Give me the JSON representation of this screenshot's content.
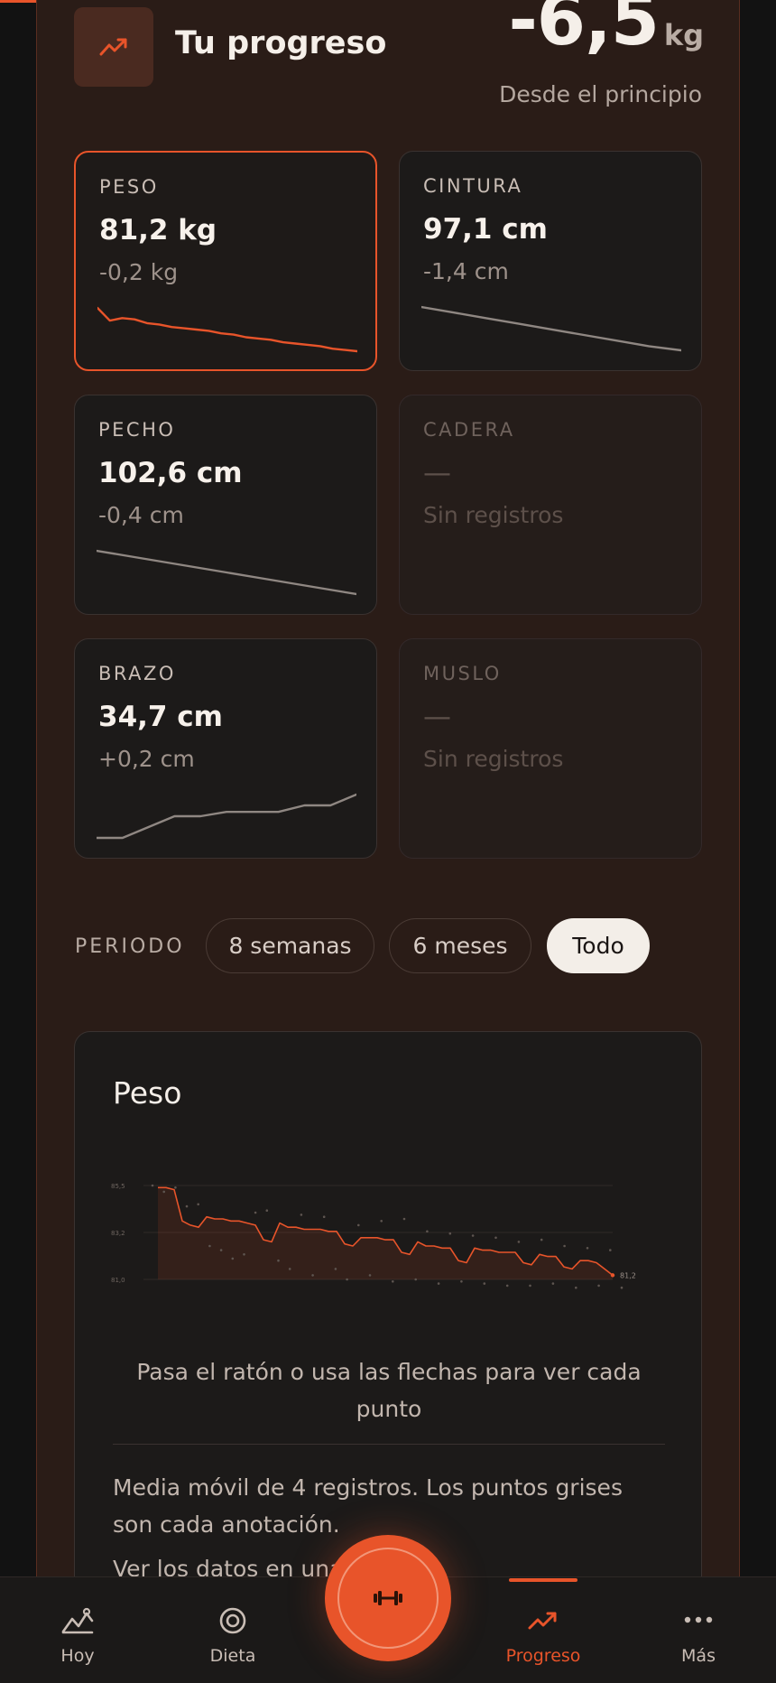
{
  "header": {
    "title": "Tu progreso",
    "total_delta": "-6,5",
    "total_unit": "kg",
    "since": "Desde el principio"
  },
  "metrics": [
    {
      "label": "PESO",
      "value": "81,2 kg",
      "delta": "-0,2 kg",
      "active": true,
      "spark": [
        84.6,
        83.6,
        83.8,
        83.7,
        83.4,
        83.3,
        83.1,
        83.0,
        82.9,
        82.8,
        82.6,
        82.5,
        82.3,
        82.2,
        82.1,
        81.9,
        81.8,
        81.7,
        81.6,
        81.4,
        81.3,
        81.2
      ]
    },
    {
      "label": "CINTURA",
      "value": "97,1 cm",
      "delta": "-1,4 cm",
      "spark": [
        100.2,
        99.8,
        99.4,
        99.0,
        98.6,
        98.2,
        97.8,
        97.4,
        97.1
      ]
    },
    {
      "label": "PECHO",
      "value": "102,6 cm",
      "delta": "-0,4 cm",
      "spark": [
        103.0,
        102.95,
        102.9,
        102.85,
        102.8,
        102.75,
        102.7,
        102.65,
        102.6
      ]
    },
    {
      "label": "CADERA",
      "value": "—",
      "delta": "Sin registros",
      "empty": true
    },
    {
      "label": "BRAZO",
      "value": "34,7 cm",
      "delta": "+0,2 cm",
      "spark": [
        34.5,
        34.5,
        34.55,
        34.6,
        34.6,
        34.62,
        34.62,
        34.62,
        34.65,
        34.65,
        34.7
      ]
    },
    {
      "label": "MUSLO",
      "value": "—",
      "delta": "Sin registros",
      "empty": true
    }
  ],
  "period": {
    "label": "PERIODO",
    "options": [
      "8 semanas",
      "6 meses",
      "Todo"
    ],
    "selected": "Todo"
  },
  "chart_card": {
    "title": "Peso",
    "hint": "Pasa el ratón o usa las flechas para ver cada punto",
    "note": "Media móvil de 4 registros. Los puntos grises son cada anotación.",
    "link": "Ver los datos en una"
  },
  "chart_data": {
    "type": "line",
    "title": "Peso",
    "y_ticks": [
      "85,5",
      "83,2",
      "81,0"
    ],
    "ylim": [
      81.0,
      85.5
    ],
    "end_label": "81,2",
    "series": [
      {
        "values": [
          85.4,
          85.4,
          85.3,
          83.8,
          83.6,
          83.5,
          84.0,
          83.9,
          83.9,
          83.8,
          83.8,
          83.7,
          83.6,
          82.9,
          82.8,
          83.7,
          83.5,
          83.5,
          83.4,
          83.4,
          83.4,
          83.3,
          83.3,
          82.7,
          82.6,
          83.0,
          83.0,
          83.0,
          82.9,
          82.9,
          82.3,
          82.2,
          82.8,
          82.6,
          82.6,
          82.5,
          82.5,
          81.9,
          81.8,
          82.5,
          82.4,
          82.4,
          82.3,
          82.3,
          82.3,
          81.8,
          81.7,
          82.2,
          82.1,
          82.1,
          81.6,
          81.5,
          81.9,
          81.9,
          81.8,
          81.5,
          81.2
        ]
      }
    ],
    "points": [
      85.5,
      85.2,
      85.4,
      84.5,
      84.6,
      82.6,
      82.4,
      82.0,
      82.2,
      84.2,
      84.3,
      81.9,
      81.5,
      84.1,
      81.2,
      84.0,
      81.5,
      81.0,
      83.6,
      81.2,
      83.8,
      80.9,
      83.9,
      81.0,
      83.3,
      80.8,
      83.2,
      80.9,
      83.1,
      80.8,
      83.0,
      80.7,
      82.8,
      80.7,
      82.9,
      80.8,
      82.6,
      80.6,
      82.5,
      80.7,
      82.4,
      80.6
    ]
  },
  "nav": {
    "items": [
      {
        "label": "Hoy",
        "icon": "mountain-chart-icon"
      },
      {
        "label": "Dieta",
        "icon": "target-icon"
      },
      {
        "label": "Progreso",
        "icon": "trend-up-icon",
        "active": true
      },
      {
        "label": "Más",
        "icon": "more-dots-icon"
      }
    ],
    "fab_icon": "dumbbell-icon"
  },
  "colors": {
    "accent": "#e8542a",
    "panel": "#2a1c17",
    "card": "#1c1a19"
  }
}
